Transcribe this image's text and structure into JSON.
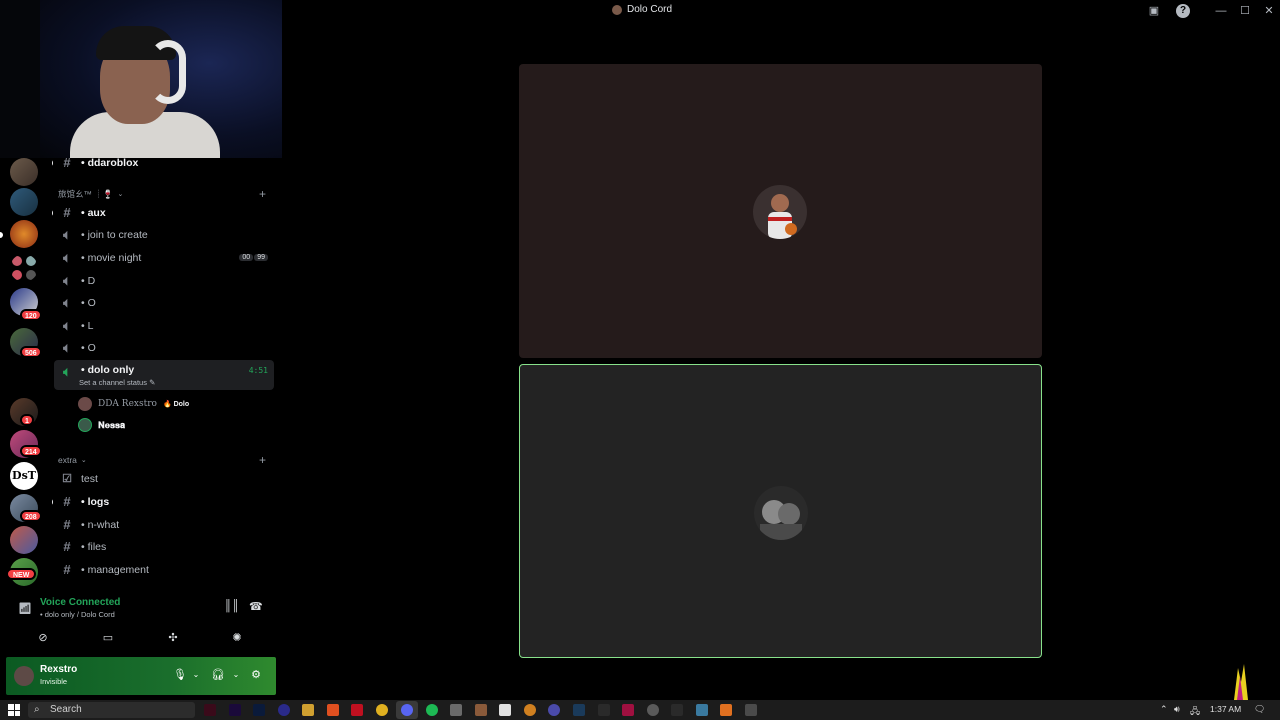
{
  "window": {
    "title": "Dolo Cord",
    "icons": [
      "inbox-icon",
      "help-icon",
      "minimize-icon",
      "maximize-icon",
      "close-icon"
    ]
  },
  "servers": {
    "badges": [
      "120",
      "506",
      "1",
      "214",
      "208",
      "NEW"
    ]
  },
  "channel_list": {
    "top_channel": "• ddaroblox",
    "category_1": "旅馆ㄠ™ ┊🍷",
    "channels": [
      {
        "name": "• aux",
        "type": "text",
        "unread": true
      },
      {
        "name": "• join to create",
        "type": "voice"
      },
      {
        "name": "• movie night",
        "type": "voice",
        "user_limit": [
          "00",
          "99"
        ]
      },
      {
        "name": "• D",
        "type": "voice"
      },
      {
        "name": "• O",
        "type": "voice"
      },
      {
        "name": "• L",
        "type": "voice"
      },
      {
        "name": "• O",
        "type": "voice"
      }
    ],
    "active_voice": {
      "name": "• dolo only",
      "timer": "4:51",
      "status_prompt": "Set a channel status",
      "members": [
        {
          "name": "DDA Rexstro",
          "tag": "🔥 Dolo"
        },
        {
          "name": "𝐍𝐞𝐬𝐬𝐚"
        }
      ]
    },
    "category_2": "extra",
    "extra_channels": [
      {
        "name": "test",
        "type": "rules"
      },
      {
        "name": "• logs",
        "type": "text",
        "unread": true
      },
      {
        "name": "• n-what",
        "type": "text"
      },
      {
        "name": "• files",
        "type": "text"
      },
      {
        "name": "• management",
        "type": "text"
      }
    ]
  },
  "voice": {
    "title": "Voice Connected",
    "subtitle": "• dolo only / Dolo Cord"
  },
  "user": {
    "name": "Rexstro",
    "status": "Invisible"
  },
  "taskbar": {
    "search_placeholder": "Search",
    "time": "1:37 AM"
  },
  "colors": {
    "accent_green": "#23a55a",
    "speaking_border": "#88e28b",
    "badge_red": "#f23f43"
  }
}
